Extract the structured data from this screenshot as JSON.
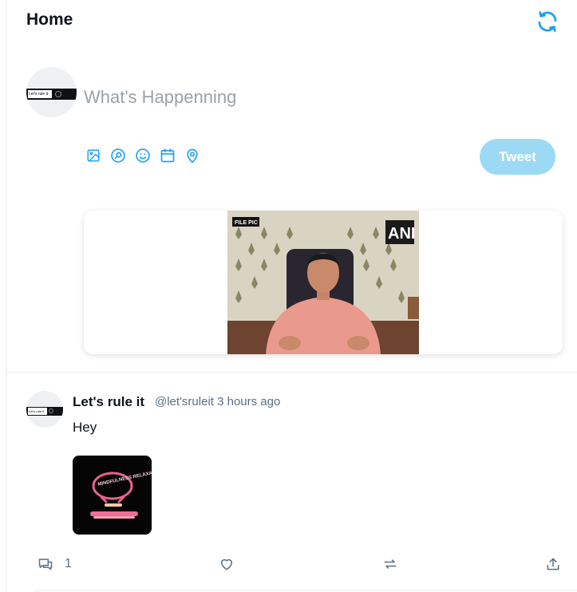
{
  "header": {
    "title": "Home",
    "refresh_icon": "refresh-icon"
  },
  "composer": {
    "avatar_label": "Let's rule it",
    "placeholder": "What's Happenning",
    "tools": [
      "image-icon",
      "gif-search-icon",
      "emoji-icon",
      "calendar-icon",
      "location-icon"
    ],
    "tweet_label": "Tweet"
  },
  "preview": {
    "badge_left": "FILE PIC",
    "badge_right": "ANI"
  },
  "tweet": {
    "name": "Let's rule it",
    "handle_time": "@let'sruleit 3 hours ago",
    "text": "Hey",
    "avatar_label": "Let's rule it",
    "media_text": "MINDFULNESS RELAXATION",
    "actions": {
      "reply_count": "1"
    }
  },
  "colors": {
    "accent": "#1da1f2",
    "tweet_button_disabled": "#9cd9f5",
    "muted_text": "#5b7083"
  }
}
